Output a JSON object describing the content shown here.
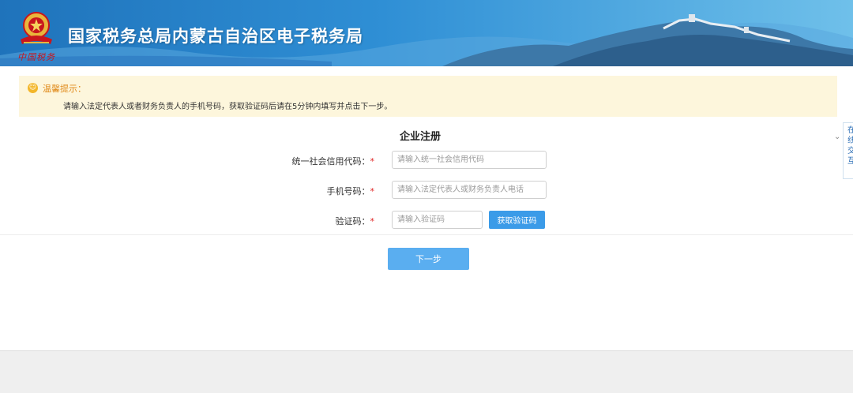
{
  "header": {
    "title": "国家税务总局内蒙古自治区电子税务局",
    "seal_text": "中国税务"
  },
  "tip": {
    "icon": "smile-icon",
    "title": "温馨提示：",
    "body": "请输入法定代表人或者财务负责人的手机号码，获取验证码后请在5分钟内填写并点击下一步。"
  },
  "form": {
    "title": "企业注册",
    "credit_code": {
      "label": "统一社会信用代码：",
      "placeholder": "请输入统一社会信用代码",
      "value": ""
    },
    "phone": {
      "label": "手机号码：",
      "placeholder": "请输入法定代表人或财务负责人电话",
      "value": ""
    },
    "code": {
      "label": "验证码：",
      "placeholder": "请输入验证码",
      "value": ""
    },
    "required_mark": "*",
    "get_code_label": "获取验证码",
    "next_label": "下一步"
  },
  "side_tab": {
    "text": "在线交互"
  },
  "colors": {
    "banner": "#2f8fd5",
    "primary_button": "#3b9be8",
    "next_button": "#5aaef0",
    "tip_background": "#fdf6dc",
    "required": "#e02222"
  }
}
